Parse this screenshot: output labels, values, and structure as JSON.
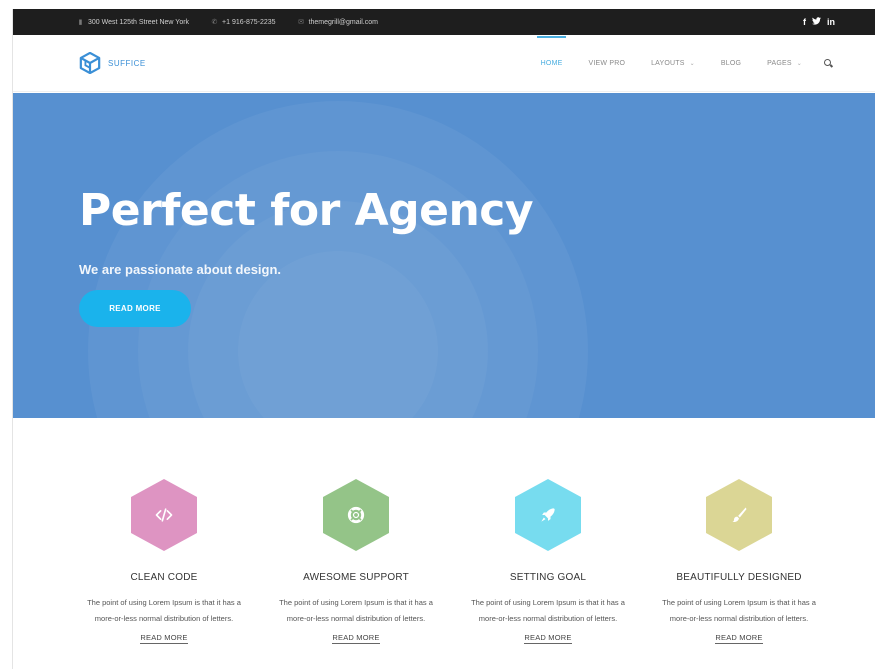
{
  "topbar": {
    "address": "300 West 125th Street New York",
    "phone": "+1 916-875-2235",
    "email": "themegrill@gmail.com",
    "social": [
      "f",
      "t",
      "in"
    ]
  },
  "header": {
    "logo_text": "SUFFICE",
    "nav": [
      {
        "label": "HOME",
        "active": true
      },
      {
        "label": "VIEW PRO"
      },
      {
        "label": "LAYOUTS",
        "dropdown": true
      },
      {
        "label": "BLOG"
      },
      {
        "label": "PAGES",
        "dropdown": true
      }
    ],
    "search_icon": "search-icon"
  },
  "hero": {
    "title": "Perfect for Agency",
    "subtitle": "We are passionate about design.",
    "button": "READ MORE",
    "background": "#5790d0",
    "button_color": "#1ab3ec"
  },
  "features": [
    {
      "title": "CLEAN CODE",
      "icon": "code-icon",
      "color": "#de94c2",
      "desc": "The point of using Lorem Ipsum is that it has a more-or-less normal distribution of letters.",
      "more": "READ MORE"
    },
    {
      "title": "AWESOME SUPPORT",
      "icon": "lifebuoy-icon",
      "color": "#94c488",
      "desc": "The point of using Lorem Ipsum is that it has a more-or-less normal distribution of letters.",
      "more": "READ MORE"
    },
    {
      "title": "SETTING GOAL",
      "icon": "rocket-icon",
      "color": "#77dcef",
      "desc": "The point of using Lorem Ipsum is that it has a more-or-less normal distribution of letters.",
      "more": "READ MORE"
    },
    {
      "title": "BEAUTIFULLY DESIGNED",
      "icon": "brush-icon",
      "color": "#dbd695",
      "desc": "The point of using Lorem Ipsum is that it has a more-or-less normal distribution of letters.",
      "more": "READ MORE"
    }
  ]
}
